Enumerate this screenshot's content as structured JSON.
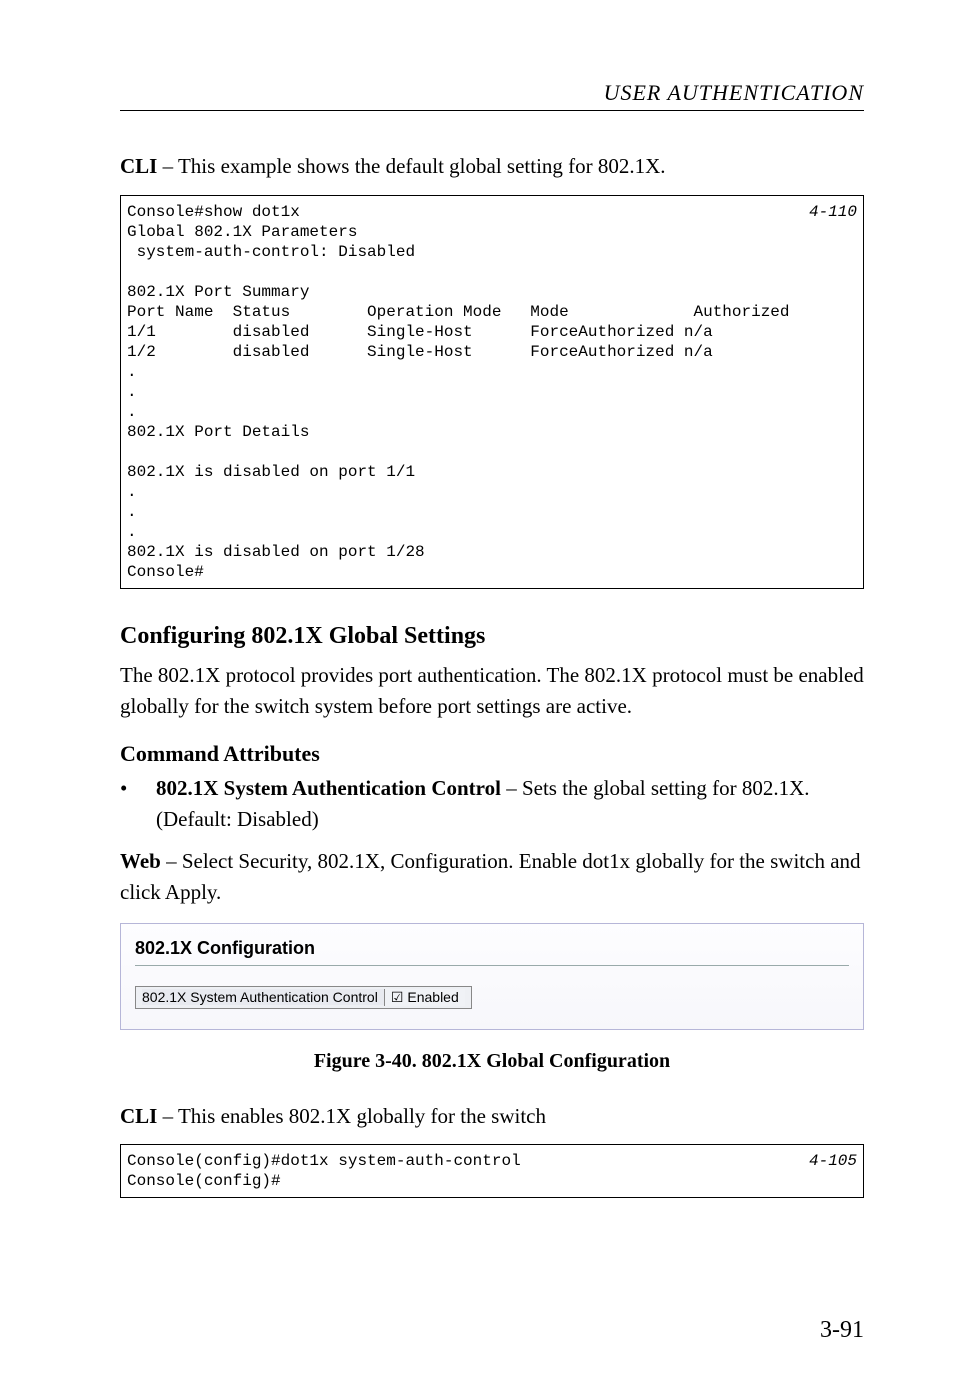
{
  "header": "USER AUTHENTICATION",
  "intro1_bold": "CLI",
  "intro1_rest": " – This example shows the default global setting for 802.1X.",
  "code1": {
    "line1_left": "Console#show dot1x",
    "line1_right": "4-110",
    "body1": "Global 802.1X Parameters\n system-auth-control: Disabled\n\n802.1X Port Summary\n",
    "table": "Port Name  Status        Operation Mode   Mode             Authorized\n1/1        disabled      Single-Host      ForceAuthorized n/a\n1/2        disabled      Single-Host      ForceAuthorized n/a",
    "body2": "802.1X Port Details\n\n802.1X is disabled on port 1/1",
    "body3": "802.1X is disabled on port 1/28\nConsole#"
  },
  "h2": "Configuring 802.1X Global Settings",
  "para1": "The 802.1X protocol provides port authentication. The 802.1X protocol must be enabled globally for the switch system before port settings are active.",
  "h3": "Command Attributes",
  "bullet1_bold": "802.1X System Authentication Control",
  "bullet1_rest": " – Sets the global setting for 802.1X. (Default: Disabled)",
  "para2_bold": "Web",
  "para2_rest": " – Select Security, 802.1X, Configuration. Enable dot1x globally for the switch and click Apply.",
  "ui": {
    "title": "802.1X Configuration",
    "label": "802.1X System Authentication Control",
    "enabled_text": "Enabled",
    "checked": true
  },
  "figcap": "Figure 3-40.  802.1X Global Configuration",
  "intro2_bold": "CLI",
  "intro2_rest": " – This enables 802.1X globally for the switch",
  "code2": {
    "line1_left": "Console(config)#dot1x system-auth-control",
    "line1_right": "4-105",
    "line2": "Console(config)#"
  },
  "pagenum": "3-91"
}
